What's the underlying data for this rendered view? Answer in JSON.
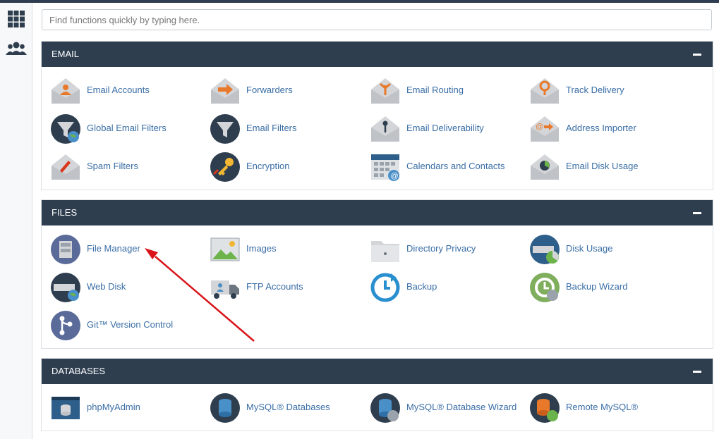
{
  "search": {
    "placeholder": "Find functions quickly by typing here."
  },
  "sidebar": {
    "items": [
      {
        "icon": "grid-icon"
      },
      {
        "icon": "users-icon"
      }
    ]
  },
  "panels": [
    {
      "title": "EMAIL",
      "items": [
        {
          "label": "Email Accounts",
          "icon": "email-accounts-icon"
        },
        {
          "label": "Forwarders",
          "icon": "forwarders-icon"
        },
        {
          "label": "Email Routing",
          "icon": "email-routing-icon"
        },
        {
          "label": "Track Delivery",
          "icon": "track-delivery-icon"
        },
        {
          "label": "Global Email Filters",
          "icon": "global-email-filters-icon"
        },
        {
          "label": "Email Filters",
          "icon": "email-filters-icon"
        },
        {
          "label": "Email Deliverability",
          "icon": "email-deliverability-icon"
        },
        {
          "label": "Address Importer",
          "icon": "address-importer-icon"
        },
        {
          "label": "Spam Filters",
          "icon": "spam-filters-icon"
        },
        {
          "label": "Encryption",
          "icon": "encryption-icon"
        },
        {
          "label": "Calendars and Contacts",
          "icon": "calendar-icon"
        },
        {
          "label": "Email Disk Usage",
          "icon": "email-disk-usage-icon"
        }
      ]
    },
    {
      "title": "FILES",
      "items": [
        {
          "label": "File Manager",
          "icon": "file-manager-icon"
        },
        {
          "label": "Images",
          "icon": "images-icon"
        },
        {
          "label": "Directory Privacy",
          "icon": "folder-icon"
        },
        {
          "label": "Disk Usage",
          "icon": "disk-usage-icon"
        },
        {
          "label": "Web Disk",
          "icon": "web-disk-icon"
        },
        {
          "label": "FTP Accounts",
          "icon": "ftp-truck-icon"
        },
        {
          "label": "Backup",
          "icon": "backup-icon"
        },
        {
          "label": "Backup Wizard",
          "icon": "backup-wizard-icon"
        },
        {
          "label": "Git™ Version Control",
          "icon": "git-icon"
        }
      ]
    },
    {
      "title": "DATABASES",
      "items": [
        {
          "label": "phpMyAdmin",
          "icon": "phpmyadmin-icon"
        },
        {
          "label": "MySQL® Databases",
          "icon": "mysql-databases-icon"
        },
        {
          "label": "MySQL® Database Wizard",
          "icon": "mysql-wizard-icon"
        },
        {
          "label": "Remote MySQL®",
          "icon": "remote-mysql-icon"
        }
      ]
    }
  ],
  "colors": {
    "header": "#2e3e4f",
    "link": "#3a6ea5",
    "annotation_arrow": "#d9141b"
  }
}
